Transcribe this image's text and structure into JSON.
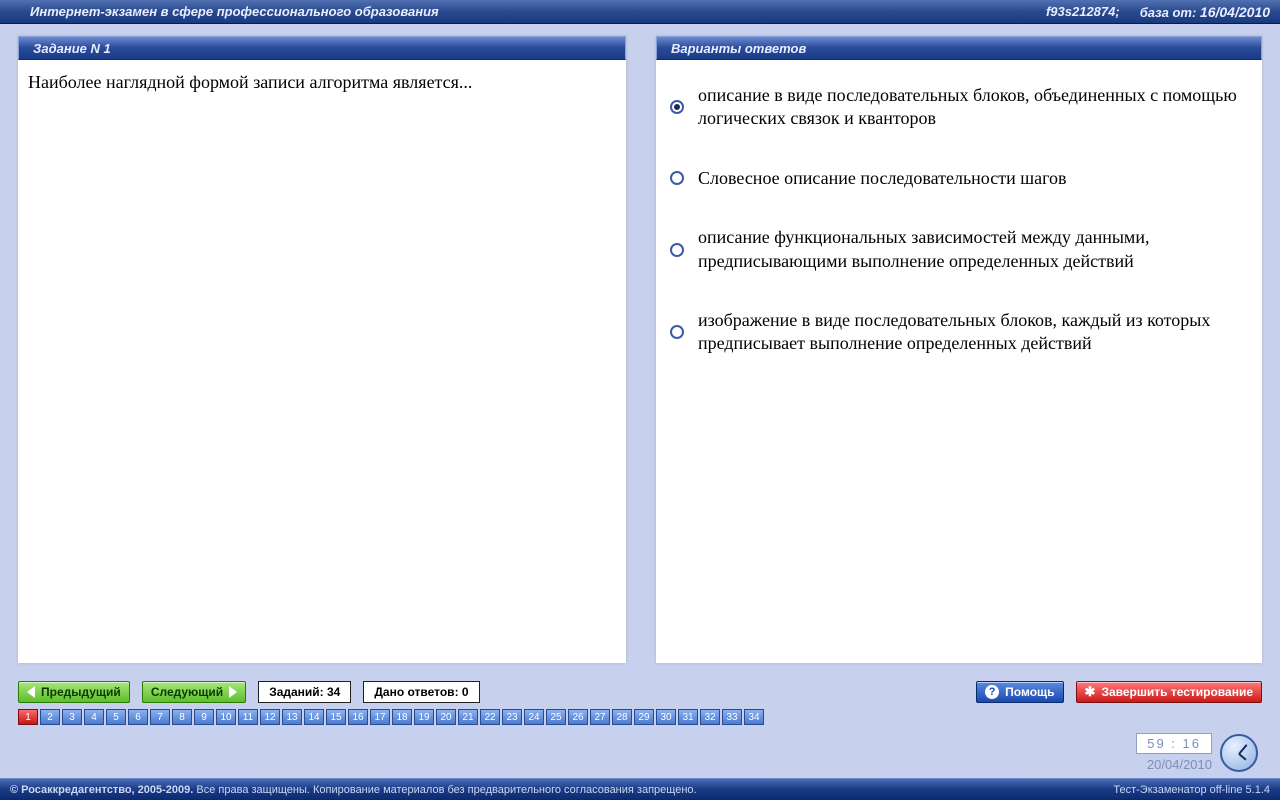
{
  "header": {
    "title": "Интернет-экзамен в сфере профессионального образования",
    "session": "f93s212874;",
    "db_label": "база от:",
    "db_date": "16/04/2010"
  },
  "question_panel": {
    "title": "Задание N 1",
    "text": "Наиболее наглядной формой записи алгоритма является..."
  },
  "answers_panel": {
    "title": "Варианты ответов",
    "options": [
      {
        "text": "описание в виде последовательных блоков, объединенных с помощью логических связок и кванторов",
        "checked": true
      },
      {
        "text": "Словесное описание последовательности шагов",
        "checked": false
      },
      {
        "text": "описание функциональных зависимостей между данными, предписывающими выполнение определенных действий",
        "checked": false
      },
      {
        "text": "изображение в виде последовательных блоков, каждый из которых предписывает выполнение определенных действий",
        "checked": false
      }
    ]
  },
  "controls": {
    "prev": "Предыдущий",
    "next": "Следующий",
    "tasks_label": "Заданий: 34",
    "answered_label": "Дано ответов: 0",
    "help": "Помощь",
    "finish": "Завершить тестирование"
  },
  "nav": {
    "count": 34,
    "current": 1
  },
  "clock": {
    "time": "59 : 16",
    "date": "20/04/2010"
  },
  "footer": {
    "copyright": "© Росаккредагентство, 2005-2009.",
    "rights": "Все права защищены. Копирование материалов без предварительного согласования запрещено.",
    "version": "Тест-Экзаменатор off-line 5.1.4"
  }
}
